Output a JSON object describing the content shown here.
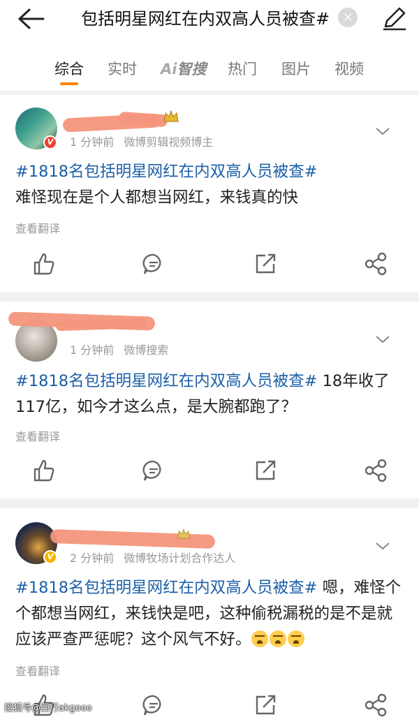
{
  "header": {
    "query": "包括明星网红在内双高人员被查#",
    "clear_glyph": "×"
  },
  "tabs": [
    {
      "label": "综合",
      "active": true
    },
    {
      "label": "实时",
      "active": false
    },
    {
      "label": "智搜",
      "prefix": "Ai",
      "active": false
    },
    {
      "label": "热门",
      "active": false
    },
    {
      "label": "图片",
      "active": false
    },
    {
      "label": "视频",
      "active": false
    }
  ],
  "posts": [
    {
      "time": "1 分钟前",
      "source": "微博剪辑视频博主",
      "hashtag": "#1818名包括明星网红在内双高人员被查#",
      "text": "难怪现在是个人都想当网红，来钱真的快",
      "translate": "查看翻译",
      "badge": "V",
      "badge_color": "#e8432f"
    },
    {
      "time": "1 分钟前",
      "source": "微博搜索",
      "hashtag": "#1818名包括明星网红在内双高人员被查#",
      "text": " 18年收了117亿，如今才这么点，是大腕都跑了？",
      "translate": "查看翻译"
    },
    {
      "time": "2 分钟前",
      "source": "微博牧场计划合作达人",
      "hashtag": "#1818名包括明星网红在内双高人员被查#",
      "text": " 嗯，难怪个个都想当网红，来钱快是吧，这种偷税漏税的是不是就应该严查严惩呢？这个风气不好。",
      "translate": "查看翻译",
      "badge": "V",
      "badge_color": "#f5b400"
    }
  ],
  "watermark": "搜狐号@西行akgooo",
  "colors": {
    "accent": "#ff8200",
    "hashtag": "#1b5fa7",
    "meta": "#999999",
    "redaction": "#f4957c"
  },
  "icons": [
    "back-arrow-icon",
    "clear-icon",
    "edit-icon",
    "chevron-down-icon",
    "like-icon",
    "comment-icon",
    "repost-icon",
    "share-icon",
    "emoji-icon"
  ]
}
